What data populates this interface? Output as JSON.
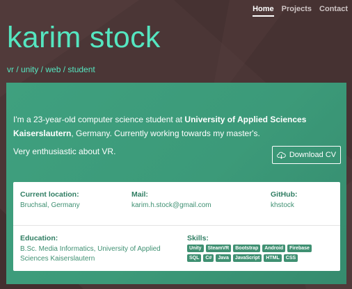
{
  "nav": {
    "items": [
      {
        "label": "Home",
        "active": true
      },
      {
        "label": "Projects",
        "active": false
      },
      {
        "label": "Contact",
        "active": false
      }
    ]
  },
  "hero": {
    "name": "karim stock",
    "tagline": "vr / unity / web / student"
  },
  "intro": {
    "part1": "I'm a 23-year-old computer science student at ",
    "university": "University of Applied Sciences Kaiserslautern",
    "part2": ", Germany. Currently working towards my master's.",
    "vr": "Very enthusiastic about VR."
  },
  "download_cv": {
    "label": "Download CV",
    "icon": "cloud-download-icon"
  },
  "info": {
    "location": {
      "label": "Current location:",
      "value": "Bruchsal, Germany"
    },
    "mail": {
      "label": "Mail:",
      "value": "karim.h.stock@gmail.com"
    },
    "github": {
      "label": "GitHub:",
      "value": "khstock"
    },
    "education": {
      "label": "Education:",
      "value": "B.Sc. Media Informatics, University of Applied Sciences Kaiserslautern"
    },
    "skills": {
      "label": "Skills:",
      "items": [
        "Unity",
        "SteamVR",
        "Bootstrap",
        "Android",
        "Firebase",
        "SQL",
        "C#",
        "Java",
        "JavaScript",
        "HTML",
        "CSS"
      ]
    }
  },
  "colors": {
    "background": "#4b3636",
    "accent": "#55e6c0",
    "card": "#3c9a79"
  }
}
